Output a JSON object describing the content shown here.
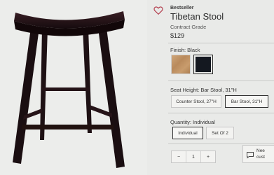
{
  "product": {
    "badge": "Bestseller",
    "title": "Tibetan Stool",
    "grade": "Contract Grade",
    "price": "$129"
  },
  "finish": {
    "label": "Finish: Black",
    "swatches": [
      {
        "name": "Natural",
        "color": "#c49a6c",
        "selected": false
      },
      {
        "name": "Black",
        "color": "#141820",
        "selected": true
      }
    ]
  },
  "seat_height": {
    "label": "Seat Height: Bar Stool, 31\"H",
    "options": [
      {
        "label": "Counter Stool, 27\"H",
        "selected": false
      },
      {
        "label": "Bar Stool, 31\"H",
        "selected": true
      }
    ]
  },
  "quantity_type": {
    "label": "Quantity: Individual",
    "options": [
      {
        "label": "Individual",
        "selected": true
      },
      {
        "label": "Set Of 2",
        "selected": false
      }
    ]
  },
  "stepper": {
    "minus": "−",
    "value": "1",
    "plus": "+"
  },
  "chat": {
    "line1": "Nee",
    "line2": "cust"
  },
  "colors": {
    "stool": "#1f1216",
    "page_bg": "#e9eae8",
    "heart": "#b23a4a"
  },
  "icons": [
    "heart-icon",
    "chat-bubble-icon"
  ]
}
